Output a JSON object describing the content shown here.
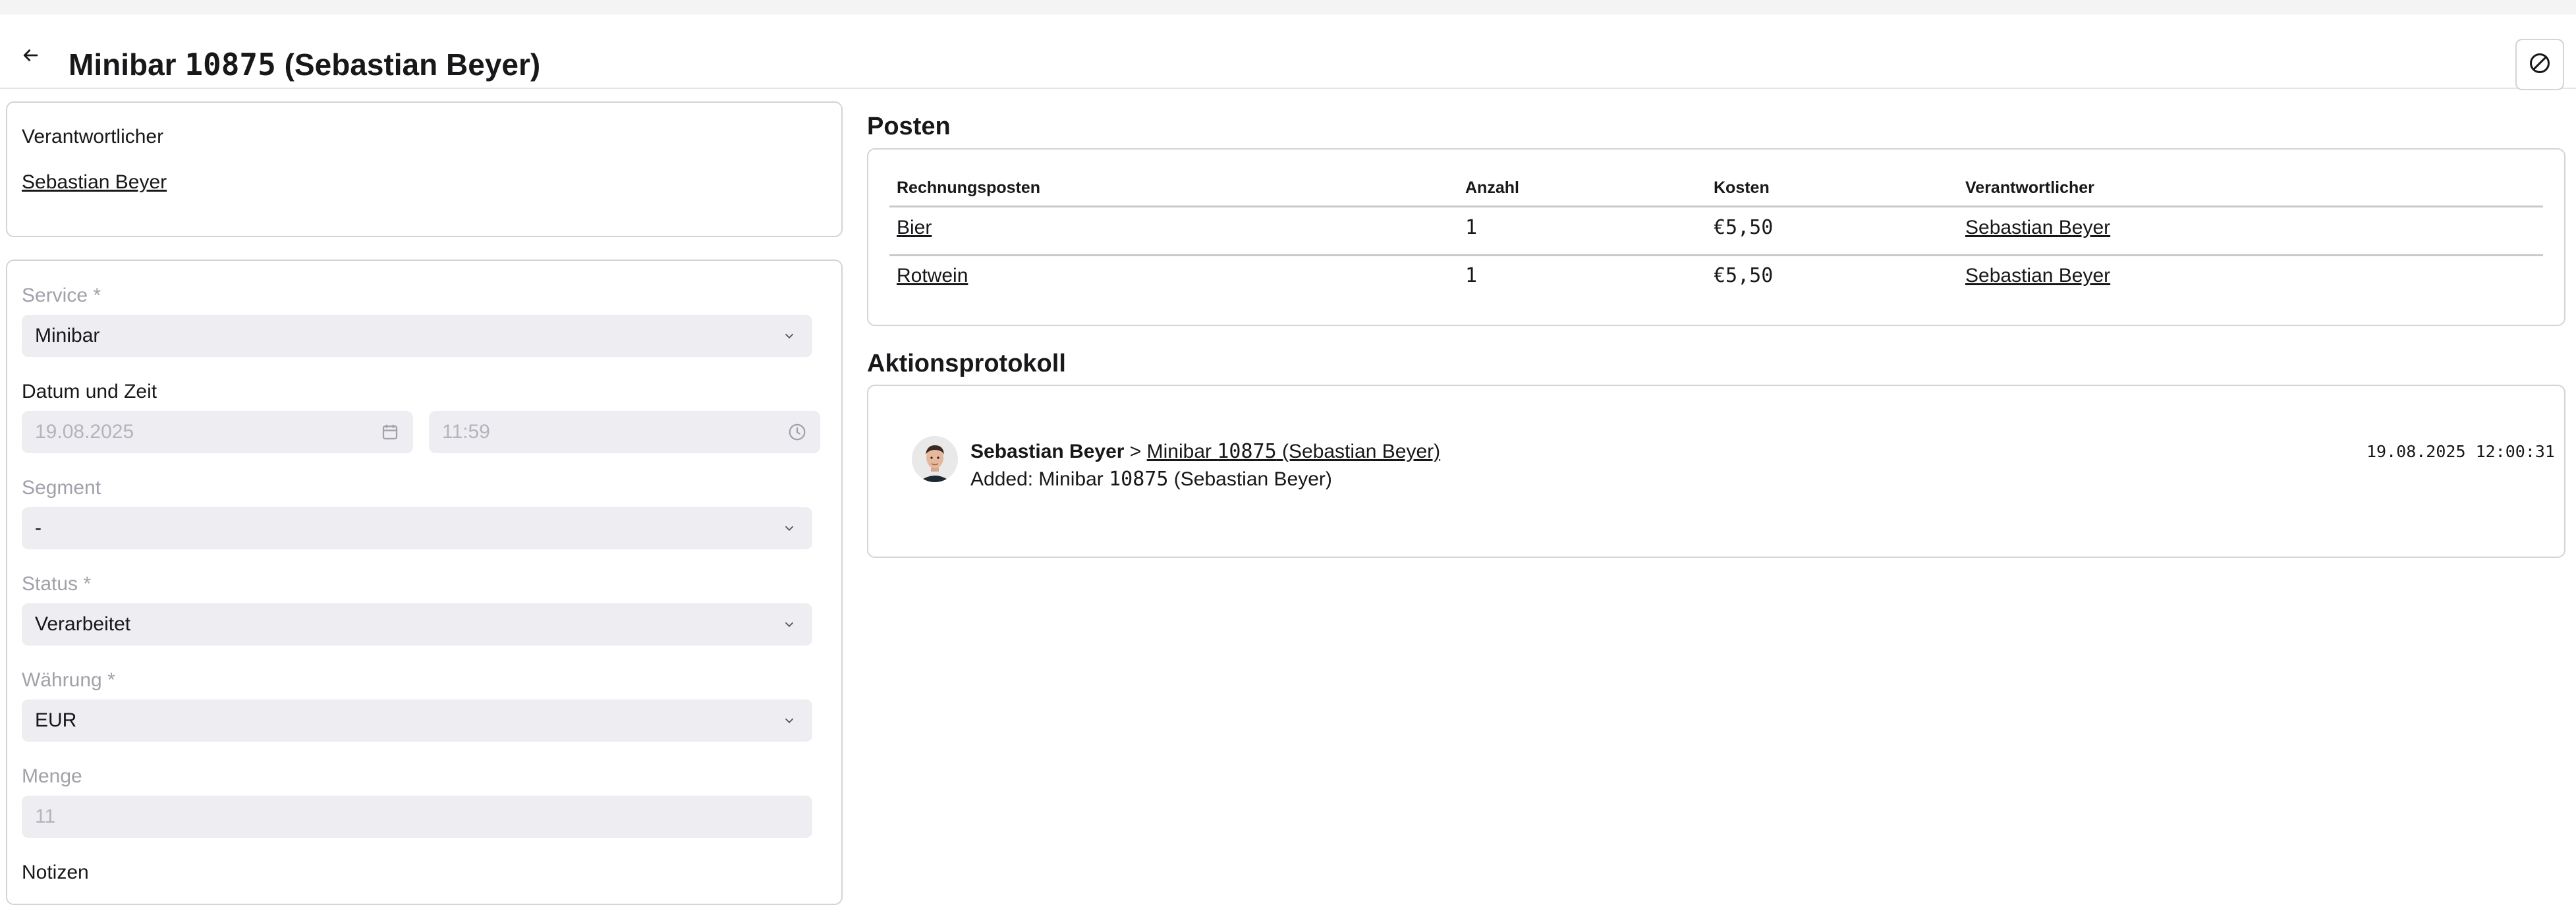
{
  "header": {
    "title_prefix": "Minibar ",
    "title_number": "10875",
    "title_suffix": " (Sebastian Beyer)",
    "back_icon": "arrow-left-icon",
    "block_icon": "ban-icon"
  },
  "responsible": {
    "label": "Verantwortlicher",
    "name": "Sebastian Beyer"
  },
  "form": {
    "service": {
      "label": "Service *",
      "value": "Minibar"
    },
    "datetime": {
      "label": "Datum und Zeit",
      "date": "19.08.2025",
      "time": "11:59"
    },
    "segment": {
      "label": "Segment",
      "value": "-"
    },
    "status": {
      "label": "Status *",
      "value": "Verarbeitet"
    },
    "currency": {
      "label": "Währung *",
      "value": "EUR"
    },
    "quantity": {
      "label": "Menge",
      "value": "11"
    },
    "notes": {
      "label": "Notizen"
    }
  },
  "posten": {
    "title": "Posten",
    "columns": [
      "Rechnungsposten",
      "Anzahl",
      "Kosten",
      "Verantwortlicher"
    ],
    "rows": [
      {
        "item": "Bier",
        "count": "1",
        "cost": "€5,50",
        "responsible": "Sebastian Beyer"
      },
      {
        "item": "Rotwein",
        "count": "1",
        "cost": "€5,50",
        "responsible": "Sebastian Beyer"
      }
    ]
  },
  "log": {
    "title": "Aktionsprotokoll",
    "entries": [
      {
        "user": "Sebastian Beyer",
        "separator": " > ",
        "target_prefix": "Minibar ",
        "target_number": "10875",
        "target_suffix": " (Sebastian Beyer)",
        "detail_prefix": "Added: Minibar ",
        "detail_number": "10875",
        "detail_suffix": " (Sebastian Beyer)",
        "timestamp": "19.08.2025 12:00:31"
      }
    ]
  },
  "colors": {
    "field_bg": "#ededf2",
    "border": "#d4d4d8",
    "muted_text": "#a1a1aa",
    "text": "#18181b"
  }
}
